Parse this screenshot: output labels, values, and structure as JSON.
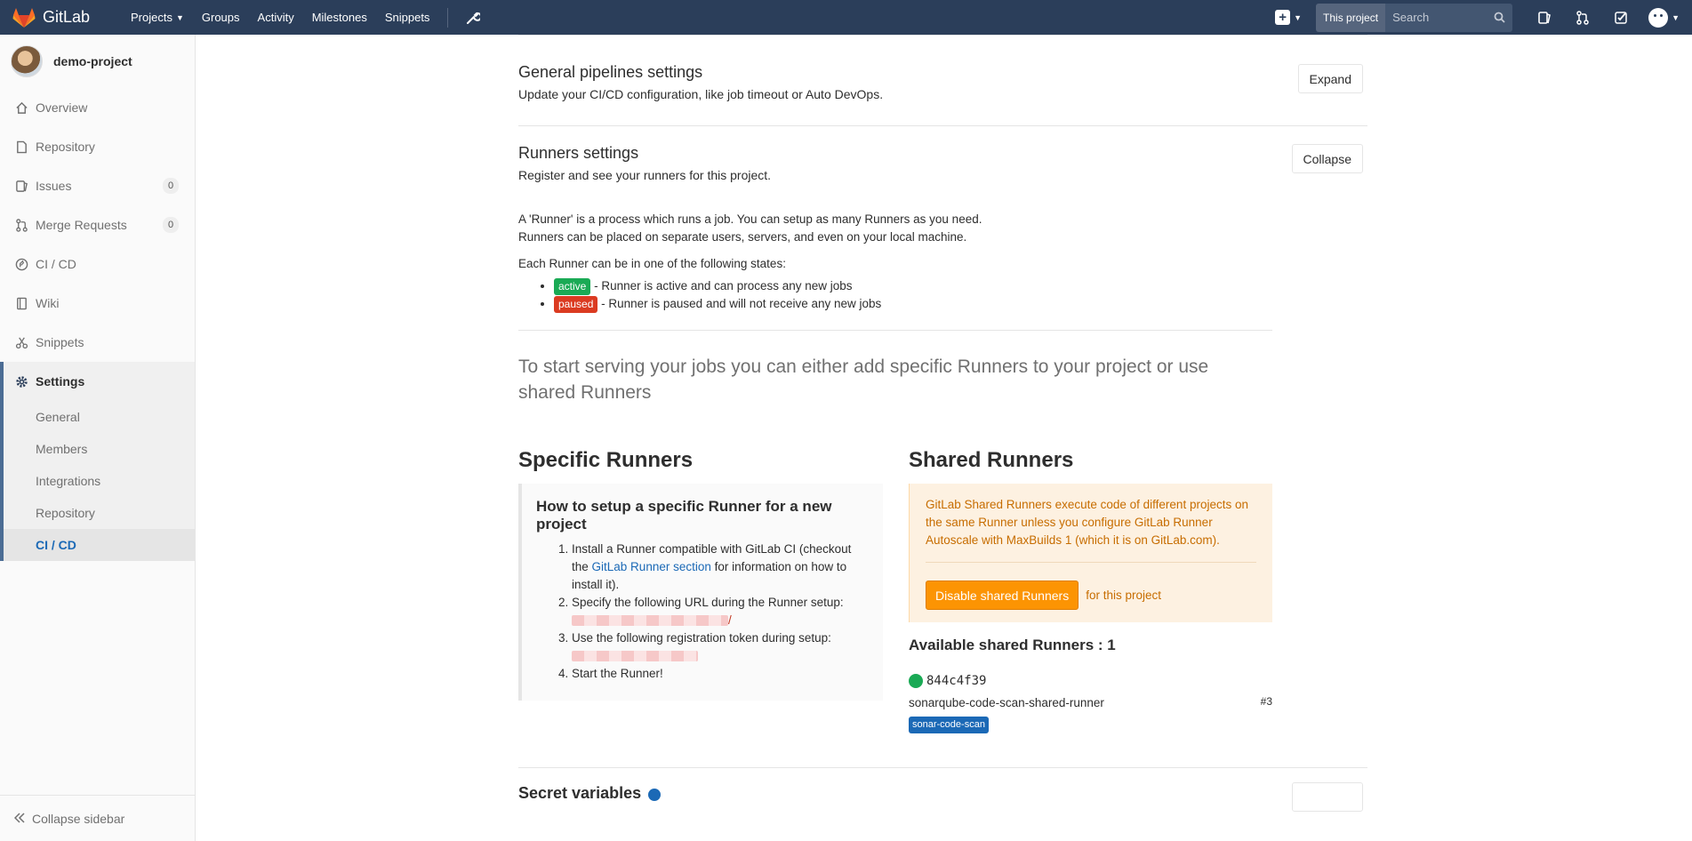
{
  "navbar": {
    "brand": "GitLab",
    "links": [
      {
        "label": "Projects",
        "has_caret": true
      },
      {
        "label": "Groups"
      },
      {
        "label": "Activity"
      },
      {
        "label": "Milestones"
      },
      {
        "label": "Snippets"
      }
    ],
    "search_scope": "This project",
    "search_placeholder": "Search"
  },
  "sidebar": {
    "project_name": "demo-project",
    "items": [
      {
        "label": "Overview",
        "icon": "home-icon"
      },
      {
        "label": "Repository",
        "icon": "doc-icon"
      },
      {
        "label": "Issues",
        "icon": "issues-icon",
        "badge": "0"
      },
      {
        "label": "Merge Requests",
        "icon": "merge-request-icon",
        "badge": "0"
      },
      {
        "label": "CI / CD",
        "icon": "rocket-icon"
      },
      {
        "label": "Wiki",
        "icon": "book-icon"
      },
      {
        "label": "Snippets",
        "icon": "scissors-icon"
      },
      {
        "label": "Settings",
        "icon": "gear-icon"
      }
    ],
    "settings_sub": [
      "General",
      "Members",
      "Integrations",
      "Repository",
      "CI / CD"
    ],
    "collapse_label": "Collapse sidebar"
  },
  "general_pipelines": {
    "title": "General pipelines settings",
    "description": "Update your CI/CD configuration, like job timeout or Auto DevOps.",
    "button": "Expand"
  },
  "runners": {
    "title": "Runners settings",
    "description": "Register and see your runners for this project.",
    "button": "Collapse",
    "intro_1": "A 'Runner' is a process which runs a job. You can setup as many Runners as you need.",
    "intro_2": "Runners can be placed on separate users, servers, and even on your local machine.",
    "states_heading": "Each Runner can be in one of the following states:",
    "state_active_label": "active",
    "state_active_text": " - Runner is active and can process any new jobs",
    "state_paused_label": "paused",
    "state_paused_text": " - Runner is paused and will not receive any new jobs",
    "lead": "To start serving your jobs you can either add specific Runners to your project or use shared Runners"
  },
  "specific": {
    "title": "Specific Runners",
    "callout_title": "How to setup a specific Runner for a new project",
    "step1_a": "Install a Runner compatible with GitLab CI (checkout the ",
    "step1_link": "GitLab Runner section",
    "step1_b": " for information on how to install it).",
    "step2": "Specify the following URL during the Runner setup:",
    "step2_url_suffix": "/",
    "step3": "Use the following registration token during setup:",
    "step4": "Start the Runner!"
  },
  "shared": {
    "title": "Shared Runners",
    "warning": "GitLab Shared Runners execute code of different projects on the same Runner unless you configure GitLab Runner Autoscale with MaxBuilds 1 (which it is on GitLab.com).",
    "disable_button": "Disable shared Runners",
    "for_project": "for this project",
    "available_title": "Available shared Runners : 1",
    "runner_token": "844c4f39",
    "runner_description": "sonarqube-code-scan-shared-runner",
    "runner_id": "#3",
    "runner_tag": "sonar-code-scan"
  },
  "next_section": {
    "title": "Secret variables"
  },
  "colors": {
    "navbar": "#2b3e5a",
    "active_label": "#1aaa55",
    "paused_label": "#db3b21",
    "warning_button": "#fc9403",
    "tag": "#1b69b6"
  }
}
